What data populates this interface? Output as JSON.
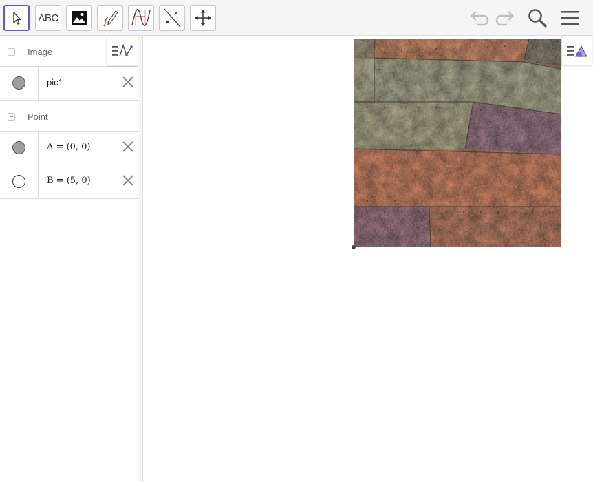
{
  "toolbar": {
    "tools": [
      {
        "name": "move-tool",
        "icon": "cursor-arrow-icon"
      },
      {
        "name": "text-tool",
        "icon": "text-icon",
        "label": "ABC"
      },
      {
        "name": "image-tool",
        "icon": "image-icon"
      },
      {
        "name": "pen-tool",
        "icon": "pen-icon"
      },
      {
        "name": "function-inspector-tool",
        "icon": "function-inspector-icon"
      },
      {
        "name": "reflect-about-line-tool",
        "icon": "reflect-line-icon"
      },
      {
        "name": "move-graphics-view-tool",
        "icon": "move-arrows-icon"
      }
    ],
    "undo_icon": "undo-icon",
    "redo_icon": "redo-icon",
    "search_icon": "search-icon",
    "menu_icon": "hamburger-menu-icon"
  },
  "algebra": {
    "groups": [
      {
        "label": "Image",
        "items": [
          {
            "text": "pic1",
            "visible": true
          }
        ]
      },
      {
        "label": "Point",
        "items": [
          {
            "text": "A = (0, 0)",
            "visible": true
          },
          {
            "text": "B = (5, 0)",
            "visible": false
          }
        ]
      }
    ]
  },
  "colors": {
    "accent": "#6557d2",
    "toolbar_bg": "#f5f5f5"
  }
}
